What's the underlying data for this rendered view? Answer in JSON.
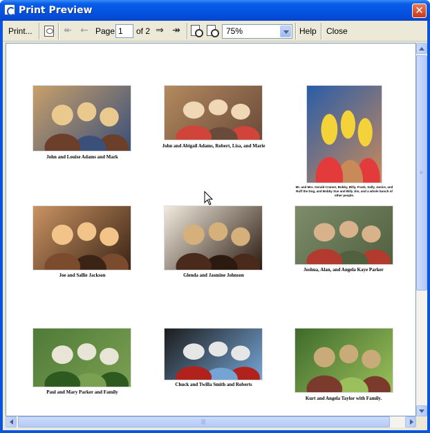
{
  "window": {
    "title": "Print Preview",
    "close_glyph": "✕"
  },
  "toolbar": {
    "print_label": "Print...",
    "page_label": "Page",
    "page_value": "1",
    "page_of": "of 2",
    "zoom_value": "75%",
    "help_label": "Help",
    "close_label": "Close",
    "first_glyph": "↞",
    "prev_glyph": "←",
    "next_glyph": "⇒",
    "last_glyph": "↠"
  },
  "photos": [
    {
      "caption": "John and Louise Adams and Mark",
      "palette": [
        "#c8a06a",
        "#6b3f2a",
        "#e9c98d",
        "#3a4f7a"
      ]
    },
    {
      "caption": "John and Abigail Adams, Robert, Lisa, and Marie",
      "palette": [
        "#b38a5f",
        "#d1443a",
        "#f0d7b5",
        "#6a4a3a"
      ]
    },
    {
      "caption": "Mr. and Mrs. Gerald Cramer, Bobby, Billy, Frank, Sally, Janice, and Ruff the Dog, and Bobby Sue and Billy Jim, and a whole bunch of other people.",
      "palette": [
        "#2a5da8",
        "#e33b3b",
        "#f4d33a",
        "#c98a5a"
      ]
    },
    {
      "caption": "Joe and Sallie Jackson",
      "palette": [
        "#c99362",
        "#7a4b2c",
        "#f2c48a",
        "#3b2416"
      ]
    },
    {
      "caption": "Glenda and Jasmine Johnson",
      "palette": [
        "#f2ecde",
        "#4a2a1a",
        "#d6b07a",
        "#2b1a10"
      ]
    },
    {
      "caption": "Joshua, Alan, and Angela Kaye Parker",
      "palette": [
        "#7d8c6a",
        "#b33a2e",
        "#d7b28a",
        "#51613f"
      ]
    },
    {
      "caption": "Paul and Mary Parker and Family",
      "palette": [
        "#4f7a38",
        "#2d5a1e",
        "#e8e4d6",
        "#7aa051"
      ]
    },
    {
      "caption": "Chuck and Twilla Smith and Roberts",
      "palette": [
        "#1c1c1c",
        "#b1221c",
        "#e6e6e6",
        "#74a4d4"
      ]
    },
    {
      "caption": "Kurt and Angela Taylor with Family.",
      "palette": [
        "#3e6b2c",
        "#7a3b2c",
        "#c9ab7a",
        "#9bbf5a"
      ]
    }
  ],
  "icons": {
    "print_setup_icon": "printer-page-icon",
    "zoom_in_icon": "zoom-in-page-icon",
    "zoom_out_icon": "zoom-out-page-icon"
  }
}
